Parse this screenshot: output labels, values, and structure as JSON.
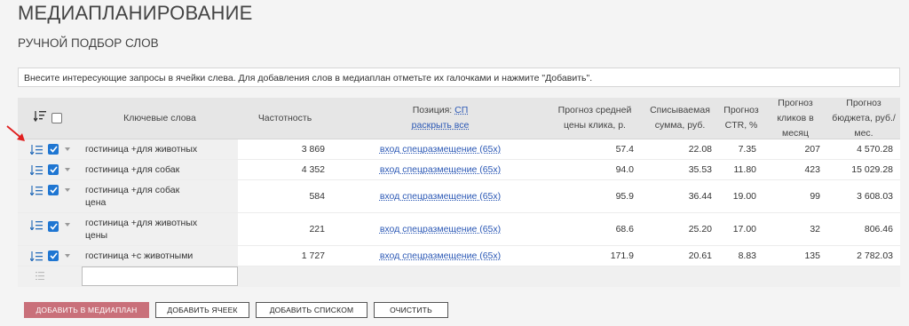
{
  "page_title": "МЕДИАПЛАНИРОВАНИЕ",
  "section_title": "РУЧНОЙ ПОДБОР СЛОВ",
  "info_text": "Внесите интересующие запросы в ячейки слева. Для добавления слов в медиаплан отметьте их галочками и нажмите \"Добавить\".",
  "columns": {
    "keywords": "Ключевые слова",
    "frequency": "Частотность",
    "position_label": "Позиция:",
    "position_value": "СП",
    "expand_all": "раскрыть все",
    "cpc_1": "Прогноз средней",
    "cpc_2": "цены клика, р.",
    "spend_1": "Списываемая",
    "spend_2": "сумма, руб.",
    "ctr_1": "Прогноз",
    "ctr_2": "CTR, %",
    "clicks_1": "Прогноз",
    "clicks_2": "кликов в месяц",
    "budget_1": "Прогноз",
    "budget_2": "бюджета, руб./мес."
  },
  "rows": [
    {
      "kw1": "гостиница +для животных",
      "kw2": "",
      "freq": "3 869",
      "pos": "вход спецразмещение (65x)",
      "cpc": "57.4",
      "spend": "22.08",
      "ctr": "7.35",
      "clicks": "207",
      "budget": "4 570.28"
    },
    {
      "kw1": "гостиница +для собак",
      "kw2": "",
      "freq": "4 352",
      "pos": "вход спецразмещение (65x)",
      "cpc": "94.0",
      "spend": "35.53",
      "ctr": "11.80",
      "clicks": "423",
      "budget": "15 029.28"
    },
    {
      "kw1": "гостиница +для собак",
      "kw2": "цена",
      "freq": "584",
      "pos": "вход спецразмещение (65x)",
      "cpc": "95.9",
      "spend": "36.44",
      "ctr": "19.00",
      "clicks": "99",
      "budget": "3 608.03"
    },
    {
      "kw1": "гостиница +для животных",
      "kw2": "цены",
      "freq": "221",
      "pos": "вход спецразмещение (65x)",
      "cpc": "68.6",
      "spend": "25.20",
      "ctr": "17.00",
      "clicks": "32",
      "budget": "806.46"
    },
    {
      "kw1": "гостиница +с животными",
      "kw2": "",
      "freq": "1 727",
      "pos": "вход спецразмещение (65x)",
      "cpc": "171.9",
      "spend": "20.61",
      "ctr": "8.83",
      "clicks": "135",
      "budget": "2 782.03"
    }
  ],
  "new_keyword_value": "",
  "buttons": {
    "add_to_plan": "ДОБАВИТЬ В МЕДИАПЛАН",
    "add_cell": "ДОБАВИТЬ ЯЧЕЕК",
    "add_list": "ДОБАВИТЬ СПИСКОМ",
    "clear": "ОЧИСТИТЬ"
  },
  "icons": {
    "sort": "sort-list-icon",
    "row_menu": "list-icon",
    "checkbox": "checkbox-checked-icon",
    "caret": "caret-down-icon",
    "annotation": "red-arrow-icon"
  },
  "colors": {
    "accent_button": "#c9707a",
    "checkbox": "#1f76d2",
    "link": "#2b58b5",
    "annotation": "#e02020"
  }
}
